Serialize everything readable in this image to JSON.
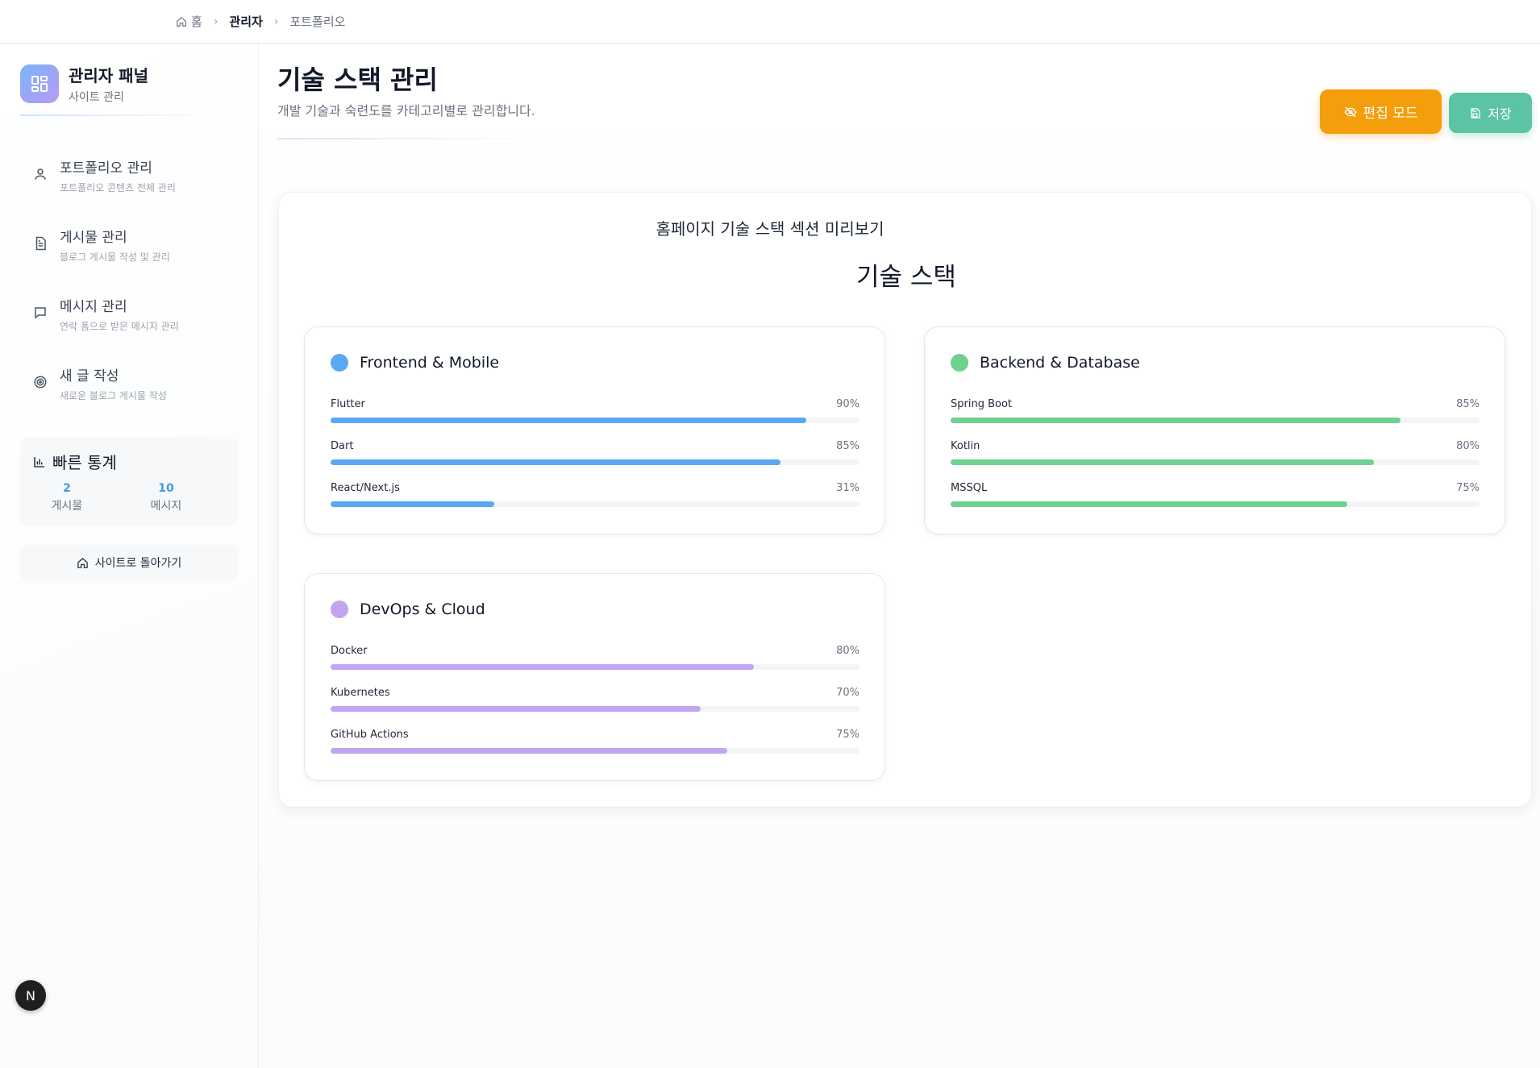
{
  "breadcrumb": {
    "home": "홈",
    "admin": "관리자",
    "current": "포트폴리오"
  },
  "sidebar": {
    "brand_title": "관리자 패널",
    "brand_sub": "사이트 관리",
    "items": [
      {
        "title": "포트폴리오 관리",
        "desc": "포트폴리오 콘텐츠 전체 관리",
        "icon": "user-icon"
      },
      {
        "title": "게시물 관리",
        "desc": "블로그 게시물 작성 및 관리",
        "icon": "document-icon"
      },
      {
        "title": "메시지 관리",
        "desc": "연락 폼으로 받은 메시지 관리",
        "icon": "message-icon"
      },
      {
        "title": "새 글 작성",
        "desc": "새로운 블로그 게시물 작성",
        "icon": "target-icon"
      }
    ],
    "stats": {
      "title": "빠른 통계",
      "posts_count": "2",
      "posts_label": "게시물",
      "messages_count": "10",
      "messages_label": "메시지"
    },
    "back_label": "사이트로 돌아가기"
  },
  "header": {
    "title": "기술 스택 관리",
    "desc": "개발 기술과 숙련도를 카테고리별로 관리합니다.",
    "edit_label": "편집 모드",
    "save_label": "저장"
  },
  "preview": {
    "label": "홈페이지 기술 스택 섹션 미리보기",
    "section_title": "기술 스택",
    "categories": [
      {
        "name": "Frontend & Mobile",
        "color": "#5aa9f0",
        "skills": [
          {
            "name": "Flutter",
            "pct": "90%",
            "level": 0.9
          },
          {
            "name": "Dart",
            "pct": "85%",
            "level": 0.85
          },
          {
            "name": "React/Next.js",
            "pct": "31%",
            "level": 0.31
          }
        ]
      },
      {
        "name": "Backend & Database",
        "color": "#6dd18f",
        "skills": [
          {
            "name": "Spring Boot",
            "pct": "85%",
            "level": 0.85
          },
          {
            "name": "Kotlin",
            "pct": "80%",
            "level": 0.8
          },
          {
            "name": "MSSQL",
            "pct": "75%",
            "level": 0.75
          }
        ]
      },
      {
        "name": "DevOps & Cloud",
        "color": "#c3a4ef",
        "skills": [
          {
            "name": "Docker",
            "pct": "80%",
            "level": 0.8
          },
          {
            "name": "Kubernetes",
            "pct": "70%",
            "level": 0.7
          },
          {
            "name": "GitHub Actions",
            "pct": "75%",
            "level": 0.75
          }
        ]
      }
    ]
  },
  "next_badge": "N"
}
